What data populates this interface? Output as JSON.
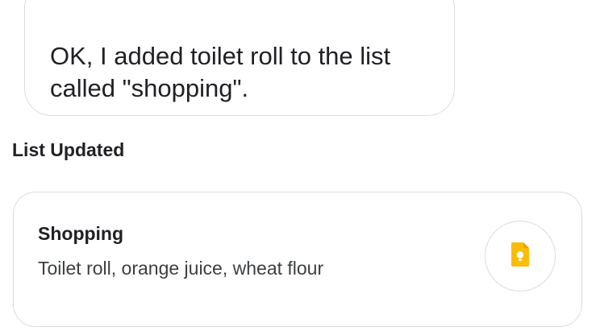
{
  "assistant": {
    "response": "OK, I added toilet roll to the list called \"shopping\"."
  },
  "section": {
    "title": "List Updated"
  },
  "list_card": {
    "title": "Shopping",
    "items": "Toilet roll, orange juice, wheat flour",
    "app_icon": "google-keep-icon",
    "app_icon_color": "#fbbc04"
  }
}
